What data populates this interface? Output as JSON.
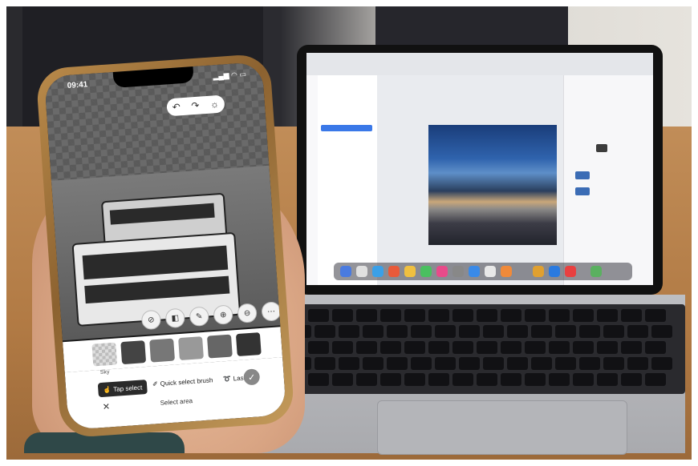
{
  "phone": {
    "status": {
      "time": "09:41"
    },
    "tools": {
      "undo_icon": "undo-icon",
      "redo_icon": "redo-icon",
      "hint_icon": "lightbulb-icon"
    },
    "selection_panel": {
      "thumbnail_label": "Sky",
      "tap_select_label": "Tap select",
      "quick_select_label": "Quick select brush",
      "lasso_label": "Lasso",
      "title": "Select area"
    }
  },
  "colors": {
    "accent": "#3a78e8",
    "dark": "#2a2a2a"
  }
}
